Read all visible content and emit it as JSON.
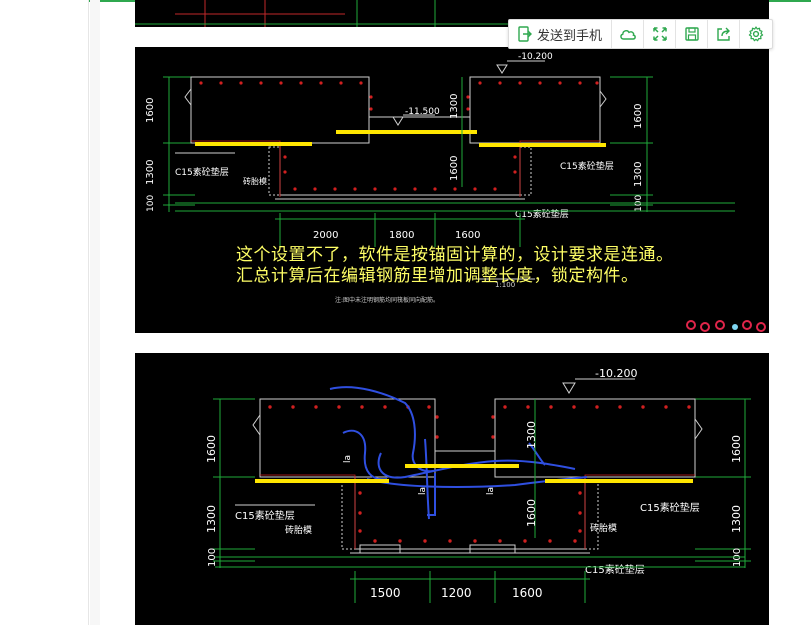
{
  "toolbar": {
    "send_label": "发送到手机",
    "icons": [
      "send-to-phone-icon",
      "cloud-icon",
      "fullscreen-icon",
      "save-icon",
      "share-icon",
      "gear-icon"
    ]
  },
  "colors": {
    "accent": "#2fa84f",
    "cad_bg": "#000000",
    "highlight": "#ffe600",
    "annotation": "#ffff66"
  },
  "image1": {
    "elev_right": "-10.200",
    "elev_mid": "-11.500",
    "dim_left": [
      "1600",
      "1300",
      "100"
    ],
    "dim_mid_height": "1300",
    "dim_mid_lower": "1600",
    "dim_right": [
      "1600",
      "1300",
      "100"
    ],
    "dim_bottom": [
      "2000",
      "1800",
      "1600"
    ],
    "label_c15_left": "C15素砼垫层",
    "label_c15_right": "C15素砼垫层",
    "label_c15_bottom": "C15素砼垫层",
    "label_brick": "砖胎模",
    "scale": "1:100",
    "note": "注:图中未注明钢筋均同筏板同向配筋。",
    "annotation_line1": "这个设置不了，软件是按锚固计算的，设计要求是连通。",
    "annotation_line2": "汇总计算后在编辑钢筋里增加调整长度，锁定构件。"
  },
  "image2": {
    "elev_right": "-10.200",
    "dim_left": [
      "1600",
      "1300",
      "100"
    ],
    "dim_mid_height": "1300",
    "dim_mid_lower": "1600",
    "dim_right": [
      "1600",
      "1300",
      "100"
    ],
    "dim_bottom": [
      "1500",
      "1200",
      "1600"
    ],
    "label_c15_left": "C15素砼垫层",
    "label_c15_right": "C15素砼垫层",
    "label_c15_bottom": "C15素砼垫层",
    "label_brick_left": "砖胎模",
    "label_brick_right": "砖胎模",
    "la": "la"
  }
}
